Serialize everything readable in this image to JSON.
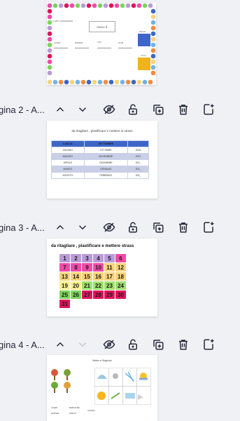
{
  "pages": [
    {
      "label": "",
      "thumb": {
        "title": "IL MIO CALENDARIO",
        "today": "OGGI: È",
        "columns": [
          "LUNEDI",
          "MARTEDI",
          "LUNI",
          "JOVEI"
        ],
        "label_top": "Risposte",
        "label_bottom": "Tempo"
      }
    },
    {
      "label": "gina 2 - A...",
      "thumb": {
        "title": "da ritagliare , plastificare e mettere lo strass",
        "rows": [
          [
            "LUGLIO",
            "SETTEMBRE",
            ""
          ],
          [
            "GIUGNO",
            "OTTOBRE",
            "2026"
          ],
          [
            "MAGGIO",
            "NOVEMBRE",
            "2027"
          ],
          [
            "APRILE",
            "DICEMBRE",
            "202_"
          ],
          [
            "MARZO",
            "GENNAIO",
            "202_"
          ],
          [
            "AGOSTO",
            "FEBBRAIO",
            "202_"
          ]
        ]
      }
    },
    {
      "label": "gina 3 - A...",
      "thumb": {
        "title": "da ritagliare , plastificare  e mettere strass",
        "cells": [
          "1",
          "2",
          "3",
          "4",
          "5",
          "6",
          "7",
          "8",
          "9",
          "10",
          "11",
          "12",
          "13",
          "14",
          "15",
          "16",
          "17",
          "18",
          "19",
          "20",
          "21",
          "22",
          "23",
          "24",
          "25",
          "26",
          "27",
          "28",
          "29",
          "30",
          "31"
        ]
      }
    },
    {
      "label": "gina 4 - A...",
      "thumb": {
        "title": "Meteo  e  Stagione",
        "labels": [
          "LUNEDI",
          "MERCOLEDI",
          "GIOVEDI",
          "MARTEDI",
          "SABATO",
          "DOMENICA"
        ]
      }
    }
  ],
  "colors": {
    "accent": "#3d66c8",
    "text": "#25283a",
    "cell_colors": [
      "#b99bd9",
      "#b99bd9",
      "#b99bd9",
      "#b99bd9",
      "#b99bd9",
      "#f04aa8",
      "#f04aa8",
      "#f04aa8",
      "#f04aa8",
      "#f04aa8",
      "#f7d37a",
      "#f7d37a",
      "#f7d37a",
      "#f7d37a",
      "#f7d37a",
      "#f7d37a",
      "#f7d37a",
      "#f7d37a",
      "#f9ef8f",
      "#f9ef8f",
      "#9de06a",
      "#9de06a",
      "#9de06a",
      "#9de06a",
      "#7ed45a",
      "#7ed45a",
      "#e0145b",
      "#e0145b",
      "#e0145b",
      "#e0145b",
      "#e0145b"
    ]
  },
  "toolbar_icons": [
    "chevron-up-icon",
    "chevron-down-icon",
    "eye-off-icon",
    "lock-open-icon",
    "duplicate-icon",
    "trash-icon",
    "add-page-icon"
  ]
}
